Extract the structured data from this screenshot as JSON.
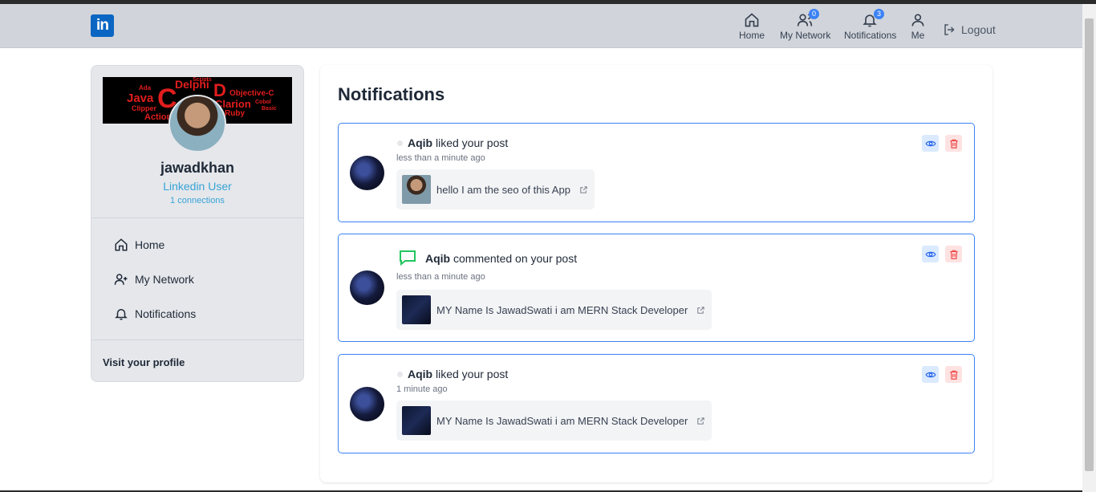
{
  "header": {
    "logo_text": "in",
    "nav": [
      {
        "label": "Home",
        "icon": "home-icon"
      },
      {
        "label": "My Network",
        "icon": "network-icon",
        "badge": "0"
      },
      {
        "label": "Notifications",
        "icon": "bell-icon",
        "badge": "3"
      },
      {
        "label": "Me",
        "icon": "user-icon"
      }
    ],
    "logout_label": "Logout"
  },
  "sidebar": {
    "username": "jawadkhan",
    "role": "Linkedin User",
    "connections": "1 connections",
    "links": [
      {
        "label": "Home",
        "icon": "home-icon"
      },
      {
        "label": "My Network",
        "icon": "user-plus-icon"
      },
      {
        "label": "Notifications",
        "icon": "bell-icon"
      }
    ],
    "visit_profile": "Visit your profile",
    "cover_words": [
      "Delphi",
      "Java",
      "C",
      "D",
      "Clarion",
      "Objective-C",
      "Ada",
      "Clipper",
      "Action",
      "Ruby",
      "Scripts",
      "Cobol",
      "Basic"
    ]
  },
  "main": {
    "title": "Notifications",
    "notifications": [
      {
        "user": "Aqib",
        "action": "liked your post",
        "time": "less than a minute ago",
        "post": "hello I am the seo of this App",
        "type": "like"
      },
      {
        "user": "Aqib",
        "action": "commented on your post",
        "time": "less than a minute ago",
        "post": "MY Name Is JawadSwati i am MERN Stack Developer",
        "type": "comment"
      },
      {
        "user": "Aqib",
        "action": "liked your post",
        "time": "1 minute ago",
        "post": "MY Name Is JawadSwati i am MERN Stack Developer",
        "type": "like"
      }
    ]
  },
  "colors": {
    "accent": "#0a66c2",
    "card_border": "#3b82f6",
    "link": "#38a3d6",
    "badge": "#3b82f6",
    "comment_icon": "#22c55e",
    "delete": "#ef4444"
  }
}
